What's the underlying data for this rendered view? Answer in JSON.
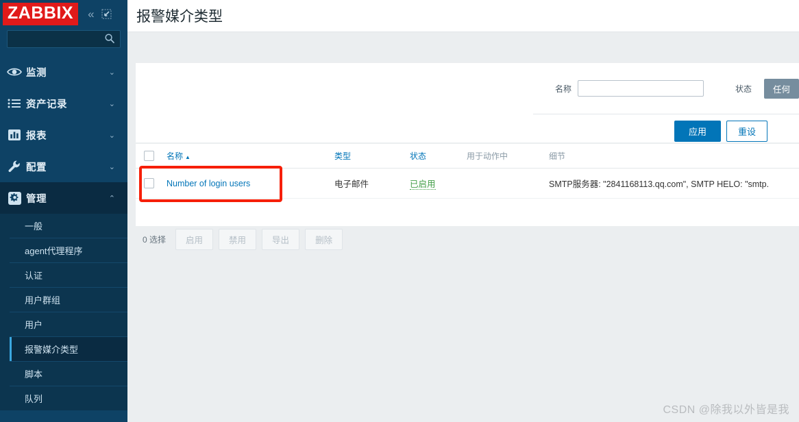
{
  "sidebar": {
    "logo": "ZABBIX",
    "collapse_icon": "chevron-double-left-icon",
    "expand_icon": "fullscreen-icon",
    "search_placeholder": "",
    "search_value": "",
    "search_icon": "search-icon",
    "nav": [
      {
        "label": "监测",
        "icon": "eye-icon",
        "chevron": "⌄",
        "expanded": false
      },
      {
        "label": "资产记录",
        "icon": "list-icon",
        "chevron": "⌄",
        "expanded": false
      },
      {
        "label": "报表",
        "icon": "chart-bar-icon",
        "chevron": "⌄",
        "expanded": false
      },
      {
        "label": "配置",
        "icon": "wrench-icon",
        "chevron": "⌄",
        "expanded": false
      },
      {
        "label": "管理",
        "icon": "gear-icon",
        "chevron": "⌃",
        "expanded": true
      }
    ],
    "submenu": [
      {
        "label": "一般",
        "active": false
      },
      {
        "label": "agent代理程序",
        "active": false
      },
      {
        "label": "认证",
        "active": false
      },
      {
        "label": "用户群组",
        "active": false
      },
      {
        "label": "用户",
        "active": false
      },
      {
        "label": "报警媒介类型",
        "active": true
      },
      {
        "label": "脚本",
        "active": false
      },
      {
        "label": "队列",
        "active": false
      }
    ]
  },
  "header": {
    "title": "报警媒介类型"
  },
  "filter": {
    "name_label": "名称",
    "name_value": "",
    "name_placeholder": "",
    "status_label": "状态",
    "status_selected": "任何",
    "apply_label": "应用",
    "reset_label": "重设"
  },
  "table": {
    "columns": {
      "name": "名称",
      "sort_arrow": "▲",
      "type": "类型",
      "status": "状态",
      "used_in_actions": "用于动作中",
      "details": "细节"
    },
    "rows": [
      {
        "name": "Number of login users",
        "type": "电子邮件",
        "status": "已启用",
        "used_in_actions": "",
        "details": "SMTP服务器: \"2841168113.qq.com\", SMTP HELO: \"smtp."
      }
    ]
  },
  "actions": {
    "selected_text": "0 选择",
    "buttons": [
      "启用",
      "禁用",
      "导出",
      "删除"
    ]
  },
  "watermark": "CSDN @除我以外皆是我",
  "colors": {
    "sidebar_bg": "#0e4265",
    "logo_bg": "#e11a1a",
    "accent_blue": "#0275b8",
    "status_green": "#429e47",
    "highlight_red": "#f61f07",
    "page_bg": "#ebeef0"
  }
}
